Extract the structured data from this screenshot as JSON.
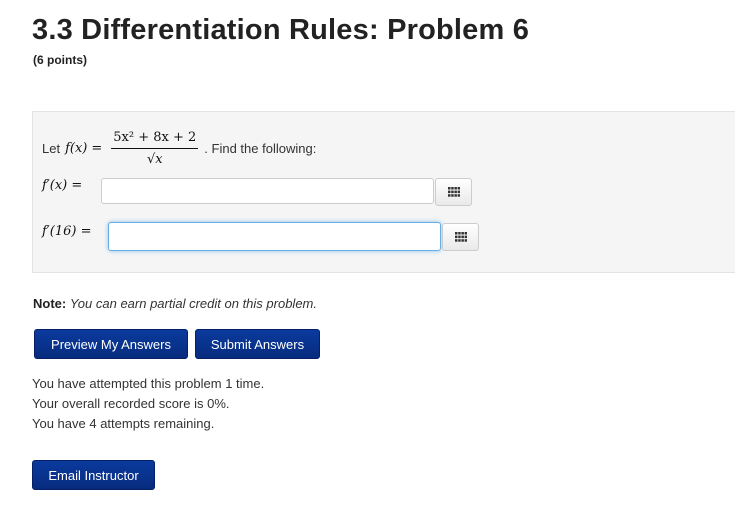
{
  "header": {
    "title": "3.3 Differentiation Rules: Problem 6",
    "points": "(6 points)"
  },
  "problem": {
    "let_text": "Let",
    "function": "f(x)",
    "equals": "=",
    "numerator": "5x² + 8x + 2",
    "denominator": "√x",
    "instruction": ". Find the following:",
    "answers": [
      {
        "label": "f′(x) =",
        "value": ""
      },
      {
        "label": "f′(16) =",
        "value": ""
      }
    ]
  },
  "note": {
    "prefix": "Note:",
    "text": "You can earn partial credit on this problem."
  },
  "buttons": {
    "preview": "Preview My Answers",
    "submit": "Submit Answers",
    "email": "Email Instructor"
  },
  "status": {
    "attempted": "You have attempted this problem 1 time.",
    "score": "Your overall recorded score is 0%.",
    "remaining": "You have 4 attempts remaining."
  },
  "colors": {
    "button_bg": "#0a3a9e",
    "box_bg": "#f5f5f5",
    "focus_border": "#66afe9"
  }
}
